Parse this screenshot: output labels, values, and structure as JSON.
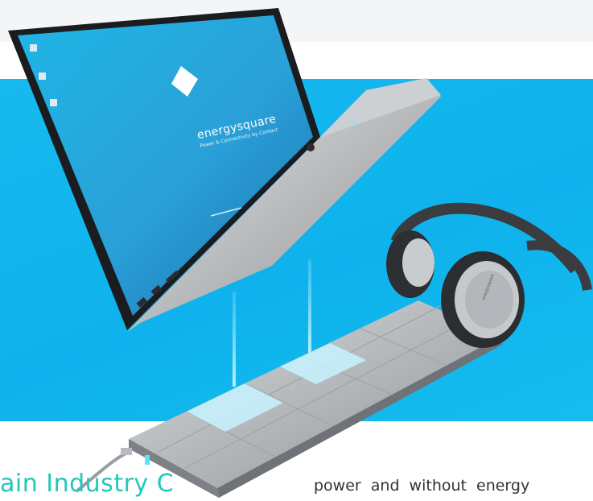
{
  "screen": {
    "brand": "energysquare",
    "tagline": "Power & Connectivity by Contact"
  },
  "caption": {
    "left": "ain Industry C",
    "right": "power and without energy"
  },
  "headphones": {
    "brand": "energysquare"
  }
}
